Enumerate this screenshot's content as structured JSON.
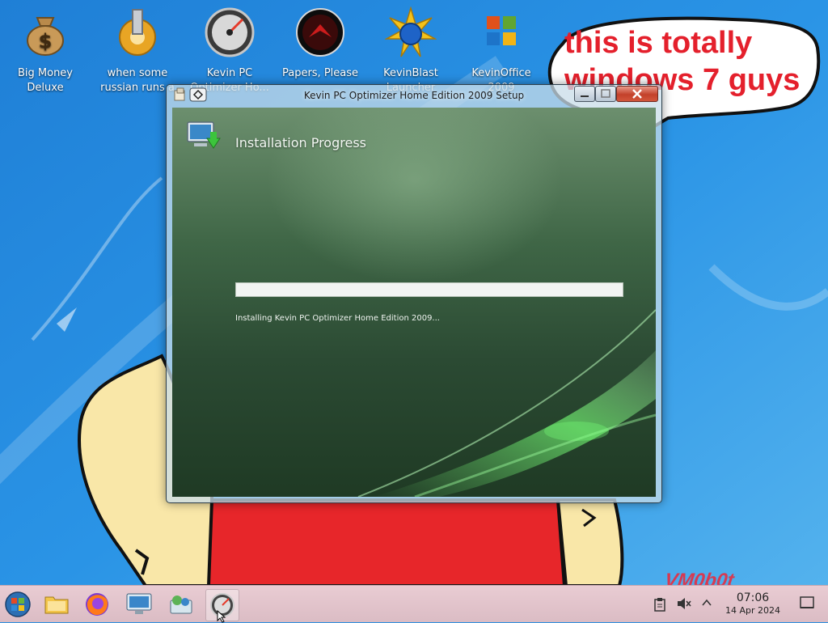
{
  "desktop": {
    "icons": [
      {
        "label": "Big Money Deluxe",
        "icon": "money-bag-icon"
      },
      {
        "label": "when some russian runs a",
        "icon": "gear-icon"
      },
      {
        "label": "Kevin PC Optimizer Ho...",
        "icon": "speedometer-icon"
      },
      {
        "label": "Papers, Please",
        "icon": "stamp-emblem-icon"
      },
      {
        "label": "KevinBlast Launcher",
        "icon": "starburst-icon"
      },
      {
        "label": "KevinOffice 2009",
        "icon": "office-logo-icon"
      }
    ],
    "speech_bubble": "this is totally windows 7 guys",
    "watermark": "VM0b0t"
  },
  "window": {
    "title": "Kevin PC Optimizer Home Edition 2009 Setup",
    "heading": "Installation Progress",
    "progress": 0,
    "status": "Installing Kevin PC Optimizer Home Edition 2009..."
  },
  "taskbar": {
    "items": [
      "start-orb",
      "file-manager",
      "firefox",
      "remote-desktop",
      "control-panel",
      "installer"
    ],
    "clock": {
      "time": "07:06",
      "date": "14 Apr 2024"
    }
  },
  "colors": {
    "desktop_blue": "#2a8fe0",
    "bubble_text": "#e4202c",
    "taskbar_pink": "#e4c6ce"
  }
}
